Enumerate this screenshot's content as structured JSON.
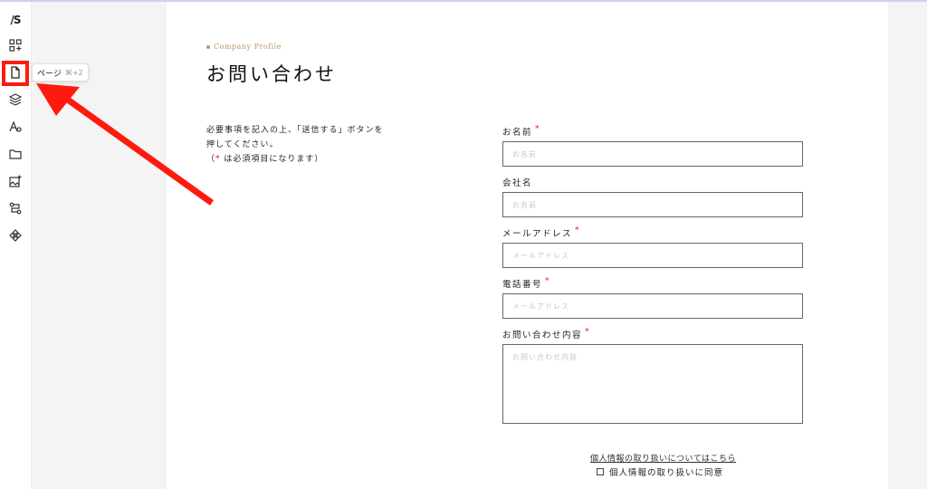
{
  "sidebar": {
    "logo": "/S",
    "icons": [
      "grid-plus-icon",
      "page-icon",
      "layers-icon",
      "typography-icon",
      "folder-icon",
      "image-add-icon",
      "workflow-icon",
      "component-icon"
    ]
  },
  "tooltip": {
    "label": "ページ",
    "shortcut": "⌘+2"
  },
  "page": {
    "eyebrow": "Company Profile",
    "title": "お問い合わせ",
    "intro_line1": "必要事項を記入の上、「送信する」ボタンを",
    "intro_line2": "押してください。",
    "intro_open": "（",
    "intro_star": "*",
    "intro_note": " は必須項目になります）"
  },
  "form": {
    "name_label": "お名前",
    "name_placeholder": "お名前",
    "company_label": "会社名",
    "company_placeholder": "お名前",
    "email_label": "メールアドレス",
    "email_placeholder": "メールアドレス",
    "phone_label": "電話番号",
    "phone_placeholder": "メールアドレス",
    "message_label": "お問い合わせ内容",
    "message_placeholder": "お問い合わせ内容",
    "required_mark": "*",
    "privacy_link": "個人情報の取り扱いについてはこちら",
    "agree_label": "個人情報の取り扱いに同意"
  },
  "colors": {
    "highlight": "#ff1a0f",
    "accent_gold": "#b59a6b",
    "required": "#e02020"
  }
}
